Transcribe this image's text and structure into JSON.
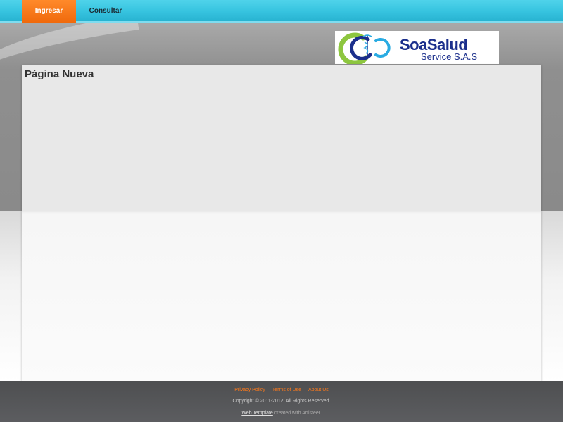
{
  "nav": {
    "items": [
      {
        "label": "Ingresar",
        "active": true
      },
      {
        "label": "Consultar",
        "active": false
      }
    ],
    "active_color": "#f57a1f",
    "bar_color": "#3cc8e2"
  },
  "logo": {
    "brand": "SoaSalud",
    "tagline": "Service S.A.S",
    "colors": {
      "green": "#8dc63f",
      "blue": "#1b2f8c",
      "cyan": "#29abe2"
    }
  },
  "main": {
    "title": "Página Nueva"
  },
  "footer": {
    "links": [
      "Privacy Policy",
      "Terms of Use",
      "About Us"
    ],
    "copyright": "Copyright © 2011-2012. All Rights Reserved.",
    "credits_link": "Web Template",
    "credits_text": "created with Artisteer."
  }
}
